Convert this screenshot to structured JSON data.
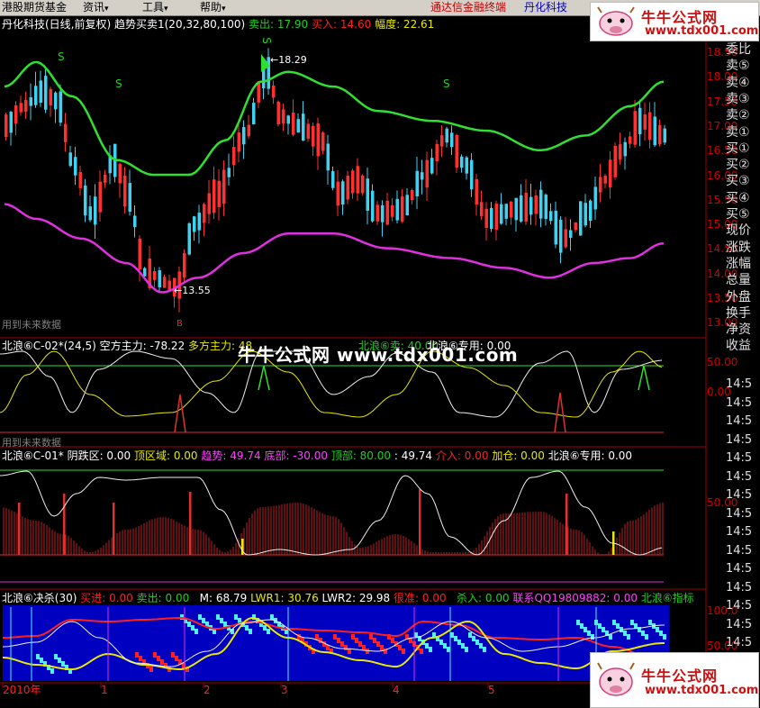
{
  "menu": {
    "items": [
      {
        "label": "港股期货基金"
      },
      {
        "label": "资讯"
      },
      {
        "label": "工具"
      },
      {
        "label": "帮助"
      }
    ],
    "right_label_1": "通达信金融终端",
    "right_label_2": "丹化科技",
    "dropdown_arrow": "▾"
  },
  "logo": {
    "title": "牛牛公式网",
    "url": "www.tdx001.com"
  },
  "watermark": "牛牛公式网 www.tdx001.com",
  "main_panel": {
    "title": "丹化科技(日线,前复权) 趋势买卖1(20,32,80,100)",
    "sell_label": "卖出: 17.90",
    "buy_label": "买入: 14.60",
    "range_label": "幅度: 22.61",
    "high_marker": "18.29",
    "low_marker": "13.55",
    "future_data_label": "用到未来数据",
    "s_markers": [
      "S",
      "S",
      "S",
      "S"
    ],
    "b_marker": "B",
    "y_ticks": [
      "18.50",
      "18.00",
      "17.50",
      "17.00",
      "16.50",
      "16.00",
      "15.50",
      "15.00",
      "14.50",
      "14.00",
      "13.50",
      "13.00"
    ]
  },
  "panel2": {
    "title": "北浪⑥C-02*(24,5)",
    "empty_label": "空方主力: -78.22",
    "long_label": "多方主力: 48",
    "sell_label": "北浪⑥卖: 40.00",
    "special_label": "北浪⑥专用: 0.00",
    "future_data_label": "用到未来数据",
    "y_ticks": [
      "50.00",
      "0.00"
    ]
  },
  "panel3": {
    "title": "北浪⑥C-01*",
    "yin_label": "阴跌区: 0.00",
    "top_zone_label": "顶区域: 0.00",
    "trend_label": "趋势: 49.74",
    "bottom_label": "底部: -30.00",
    "top_label": "顶部: 80.00",
    "val_label": ": 49.74",
    "enter_label": "介入: 0.00",
    "add_label": "加仓: 0.00",
    "special_label": "北浪⑥专用: 0.00",
    "y_ticks": [
      "50.00"
    ]
  },
  "panel4": {
    "title": "北浪⑥决杀(30)",
    "buy_label": "买进: 0.00",
    "sell_label": "卖出: 0.00",
    "m_label": "M: 68.79",
    "lwr1_label": "LWR1: 30.76",
    "lwr2_label": "LWR2: 29.98",
    "strong_label": "很准: 0.00",
    "kill_label": "杀入: 0.00",
    "contact_label": "联系QQ19809882: 0.00",
    "indicator_label": "北浪⑥指标",
    "y_ticks": [
      "100.0",
      "50.00"
    ]
  },
  "x_axis": {
    "labels": [
      "2010年",
      "1",
      "2",
      "3",
      "4",
      "5"
    ]
  },
  "side_panel": {
    "items": [
      "委比",
      "卖⑤",
      "卖④",
      "卖③",
      "卖②",
      "卖①",
      "买①",
      "买②",
      "买③",
      "买④",
      "买⑤",
      "现价",
      "涨跌",
      "涨幅",
      "总量",
      "外盘",
      "换手",
      "净资",
      "收益"
    ],
    "time_rows": [
      "14:5",
      "14:5",
      "14:5",
      "14:5",
      "14:5",
      "14:5",
      "14:5",
      "14:5",
      "14:5",
      "14:5",
      "14:5",
      "14:5",
      "14:5",
      "14:5",
      "14:5",
      "14:5"
    ]
  },
  "colors": {
    "up_candle": "#ff3030",
    "down_candle": "#40d0f0",
    "upper_band": "#30e030",
    "lower_band": "#e030e0",
    "bg": "#000000",
    "panel4_bg": "#0000c0",
    "grid_red": "#a00000"
  }
}
